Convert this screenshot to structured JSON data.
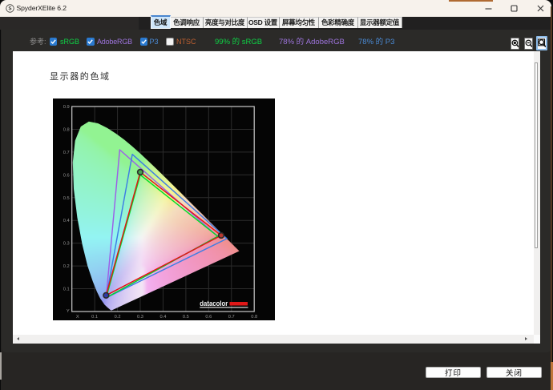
{
  "window": {
    "title": "SpyderXElite 6.2",
    "logo_letter": "S"
  },
  "tabs": {
    "items": [
      {
        "label": "色域",
        "selected": true
      },
      {
        "label": "色调响应",
        "selected": false
      },
      {
        "label": "亮度与对比度",
        "selected": false
      },
      {
        "label": "OSD 设置",
        "selected": false
      },
      {
        "label": "屏幕均匀性",
        "selected": false
      },
      {
        "label": "色彩精确度",
        "selected": false
      },
      {
        "label": "显示器额定值",
        "selected": false
      }
    ]
  },
  "toolbar": {
    "reference_label": "参考:",
    "checkboxes": [
      {
        "label": "sRGB",
        "checked": true,
        "color": "#0ed145"
      },
      {
        "label": "AdobeRGB",
        "checked": true,
        "color": "#9d74dc"
      },
      {
        "label": "P3",
        "checked": true,
        "color": "#4a8ad4"
      },
      {
        "label": "NTSC",
        "checked": false,
        "color": "#bf6030"
      }
    ],
    "stats": [
      {
        "text": "99% 的 sRGB",
        "color": "#0ed145"
      },
      {
        "text": "78% 的 AdobeRGB",
        "color": "#9d74dc"
      },
      {
        "text": "78% 的 P3",
        "color": "#4a8ad4"
      }
    ]
  },
  "page": {
    "heading": "显示器的色域"
  },
  "footer": {
    "print_label": "打印",
    "close_label": "关闭"
  },
  "chart_data": {
    "type": "line",
    "subtype": "CIE 1931 xy chromaticity diagram with gamut triangles",
    "title": "显示器的色域",
    "xlabel": "X",
    "ylabel": "Y",
    "xlim": [
      0,
      0.8
    ],
    "ylim": [
      0,
      0.9
    ],
    "xticks": [
      0.1,
      0.2,
      0.3,
      0.4,
      0.5,
      0.6,
      0.7,
      0.8
    ],
    "yticks": [
      0.1,
      0.2,
      0.3,
      0.4,
      0.5,
      0.6,
      0.7,
      0.8,
      0.9
    ],
    "grid": true,
    "background": "#050505",
    "series": [
      {
        "name": "AdobeRGB",
        "color": "#9c5fe8",
        "vertices": [
          [
            0.64,
            0.33
          ],
          [
            0.21,
            0.71
          ],
          [
            0.15,
            0.06
          ]
        ]
      },
      {
        "name": "P3",
        "color": "#3d7de4",
        "vertices": [
          [
            0.68,
            0.32
          ],
          [
            0.265,
            0.69
          ],
          [
            0.15,
            0.06
          ]
        ]
      },
      {
        "name": "sRGB",
        "color": "#00dc28",
        "vertices": [
          [
            0.64,
            0.33
          ],
          [
            0.3,
            0.6
          ],
          [
            0.15,
            0.06
          ]
        ]
      },
      {
        "name": "display",
        "color": "#e41414",
        "vertices": [
          [
            0.655,
            0.334
          ],
          [
            0.3,
            0.612
          ],
          [
            0.15,
            0.071
          ]
        ],
        "marker_colors": [
          "#b83830",
          "#46a34e",
          "#2e3aa8"
        ]
      }
    ],
    "coverage": {
      "sRGB": "99%",
      "AdobeRGB": "78%",
      "P3": "78%"
    },
    "watermark": "datacolor",
    "locus": [
      [
        0.1741,
        0.005
      ],
      [
        0.174,
        0.005
      ],
      [
        0.1738,
        0.0049
      ],
      [
        0.1733,
        0.0048
      ],
      [
        0.1726,
        0.0048
      ],
      [
        0.1714,
        0.0051
      ],
      [
        0.1689,
        0.0069
      ],
      [
        0.1644,
        0.0109
      ],
      [
        0.1566,
        0.0177
      ],
      [
        0.144,
        0.0297
      ],
      [
        0.1241,
        0.0578
      ],
      [
        0.1096,
        0.0868
      ],
      [
        0.0913,
        0.1327
      ],
      [
        0.0687,
        0.2007
      ],
      [
        0.0454,
        0.295
      ],
      [
        0.0235,
        0.4127
      ],
      [
        0.0082,
        0.5384
      ],
      [
        0.0039,
        0.6548
      ],
      [
        0.0139,
        0.7502
      ],
      [
        0.0389,
        0.812
      ],
      [
        0.0743,
        0.8338
      ],
      [
        0.1142,
        0.8262
      ],
      [
        0.1547,
        0.8059
      ],
      [
        0.1929,
        0.7816
      ],
      [
        0.2296,
        0.7543
      ],
      [
        0.2658,
        0.7243
      ],
      [
        0.3016,
        0.6923
      ],
      [
        0.3373,
        0.6589
      ],
      [
        0.3731,
        0.6245
      ],
      [
        0.4087,
        0.5896
      ],
      [
        0.4441,
        0.5547
      ],
      [
        0.4788,
        0.5202
      ],
      [
        0.5125,
        0.4866
      ],
      [
        0.5448,
        0.4544
      ],
      [
        0.5752,
        0.4242
      ],
      [
        0.6029,
        0.3965
      ],
      [
        0.627,
        0.3725
      ],
      [
        0.6482,
        0.3514
      ],
      [
        0.6658,
        0.334
      ],
      [
        0.6801,
        0.3197
      ],
      [
        0.6915,
        0.3083
      ],
      [
        0.7006,
        0.2993
      ],
      [
        0.7079,
        0.292
      ],
      [
        0.714,
        0.2859
      ],
      [
        0.719,
        0.2809
      ],
      [
        0.723,
        0.277
      ],
      [
        0.726,
        0.274
      ],
      [
        0.7283,
        0.2717
      ],
      [
        0.73,
        0.27
      ],
      [
        0.7347,
        0.2653
      ]
    ]
  }
}
